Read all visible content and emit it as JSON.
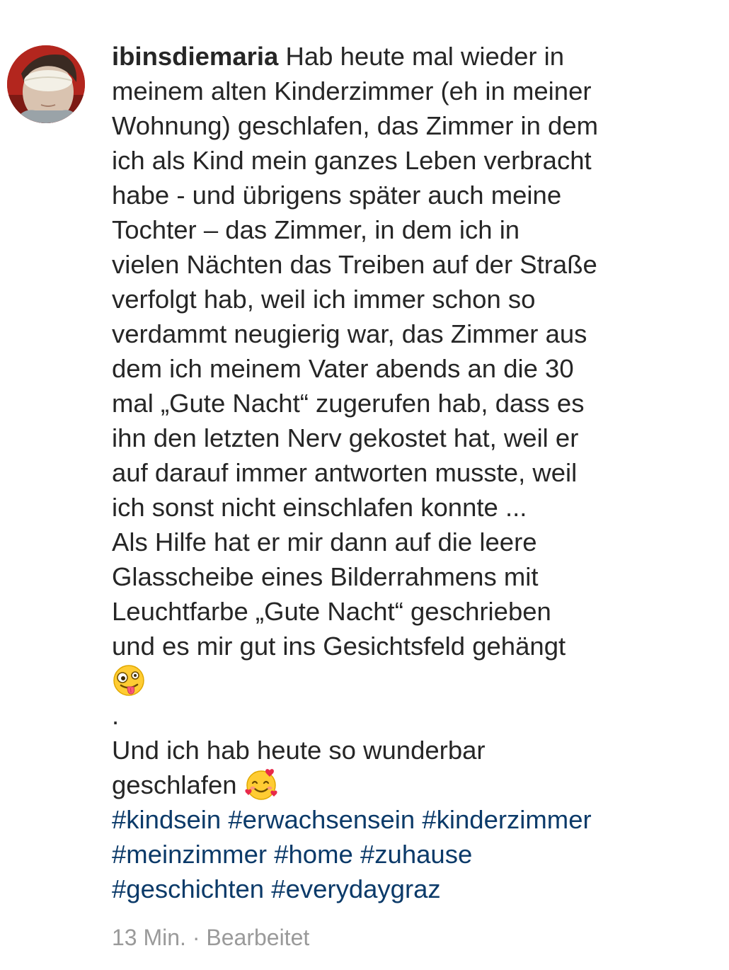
{
  "post": {
    "username": "ibinsdiemaria",
    "avatar_icon": "profile-photo-sleep-mask",
    "caption_lines": [
      "Hab heute mal wieder in",
      "meinem alten Kinderzimmer (eh in meiner",
      "Wohnung) geschlafen, das Zimmer in dem",
      "ich als Kind mein ganzes Leben verbracht",
      "habe - und übrigens später auch meine",
      "Tochter – das Zimmer, in dem ich in",
      "vielen Nächten das Treiben auf der Straße",
      "verfolgt hab, weil ich immer schon so",
      "verdammt neugierig war, das Zimmer aus",
      "dem ich meinem Vater abends an die 30",
      "mal „Gute Nacht“ zugerufen hab, dass es",
      "ihn den letzten Nerv gekostet hat, weil er",
      "auf darauf immer antworten musste, weil",
      "ich sonst nicht einschlafen konnte ...",
      "Als Hilfe hat er mir dann auf die leere",
      "Glasscheibe eines Bilderrahmens mit",
      "Leuchtfarbe „Gute Nacht“ geschrieben",
      "und es mir gut ins Gesichtsfeld gehängt"
    ],
    "emoji_1": "zany-face-emoji",
    "separator": ".",
    "closing_lines": [
      "Und ich hab heute so wunderbar",
      "geschlafen"
    ],
    "emoji_2": "smiling-face-with-hearts-emoji",
    "hashtags": [
      "#kindsein",
      "#erwachsensein",
      "#kinderzimmer",
      "#meinzimmer",
      "#home",
      "#zuhause",
      "#geschichten",
      "#everydaygraz"
    ],
    "timestamp": "13 Min.",
    "meta_separator": " · ",
    "edited_label": "Bearbeitet"
  },
  "colors": {
    "text": "#262626",
    "hashtag": "#0b3a69",
    "meta": "#9a9a9a",
    "avatar_ring_bg": "#b3261e"
  }
}
